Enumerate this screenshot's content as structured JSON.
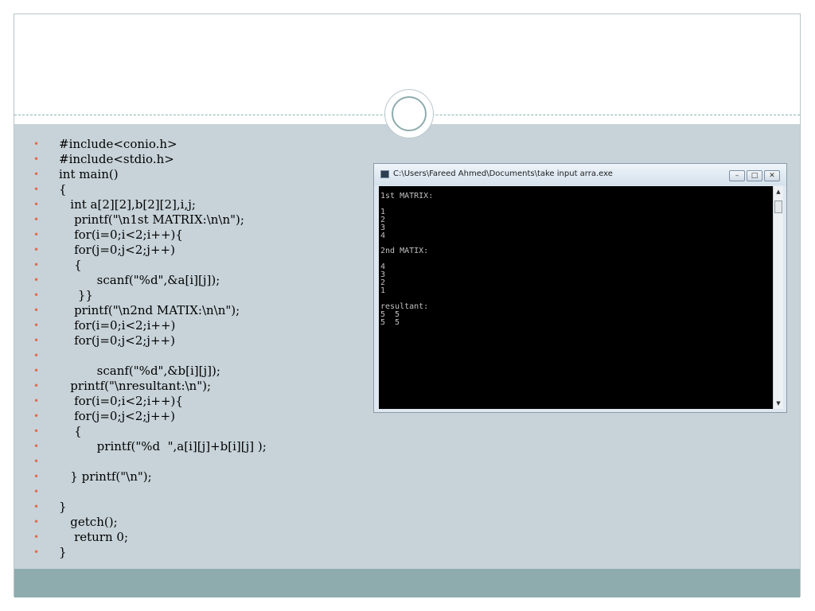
{
  "code_lines": [
    "#include<conio.h>",
    "#include<stdio.h>",
    "int main()",
    "{",
    "   int a[2][2],b[2][2],i,j;",
    "    printf(\"\\n1st MATRIX:\\n\\n\");",
    "    for(i=0;i<2;i++){",
    "    for(j=0;j<2;j++)",
    "    {",
    "          scanf(\"%d\",&a[i][j]);",
    "     }}",
    "    printf(\"\\n2nd MATIX:\\n\\n\");",
    "    for(i=0;i<2;i++)",
    "    for(j=0;j<2;j++)",
    "",
    "          scanf(\"%d\",&b[i][j]);",
    "   printf(\"\\nresultant:\\n\");",
    "    for(i=0;i<2;i++){",
    "    for(j=0;j<2;j++)",
    "    {",
    "          printf(\"%d  \",a[i][j]+b[i][j] );",
    "",
    "   } printf(\"\\n\");",
    "",
    "}",
    "   getch();",
    "    return 0;",
    "}"
  ],
  "bullet_glyph": "•",
  "console": {
    "title": "C:\\Users\\Fareed Ahmed\\Documents\\take input arra.exe",
    "output": "1st MATRIX:\n\n1\n2\n3\n4\n\n2nd MATIX:\n\n4\n3\n2\n1\n\nresultant:\n5  5\n5  5",
    "buttons": {
      "minimize": "–",
      "maximize": "□",
      "close": "✕"
    },
    "scroll_up": "▲",
    "scroll_down": "▼"
  },
  "colors": {
    "bullet": "#e06b4d",
    "main_background": "#c7d3d9",
    "footer_band": "#8eacad",
    "console_background": "#000000",
    "console_text": "#c0c0c0"
  }
}
